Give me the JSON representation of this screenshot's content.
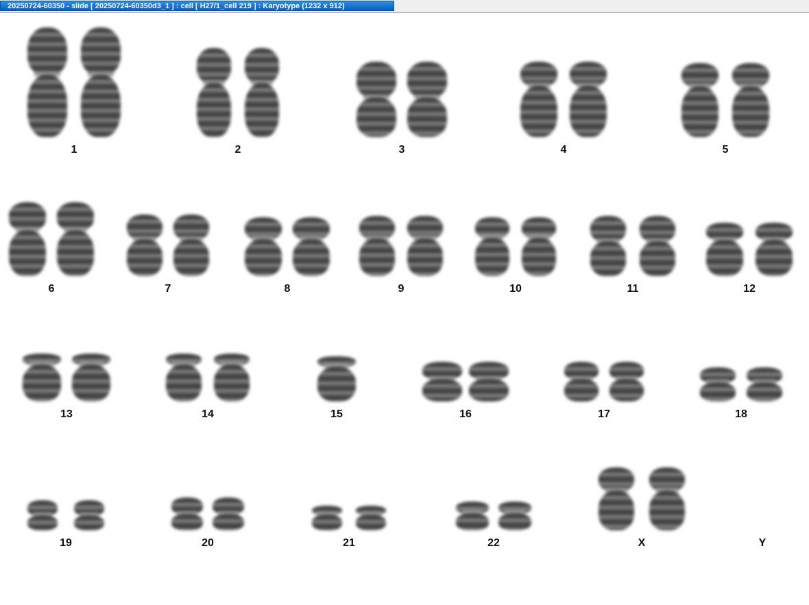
{
  "window": {
    "title": "20250724-60350 - slide [ 20250724-60350d3_1 ] : cell [ H27/1_cell 219 ] : Karyotype  (1232 x 912)"
  },
  "colors": {
    "title_bar": "#1577d6",
    "title_text": "#ffffff",
    "background": "#ffffff",
    "chromosome": "#3a3a3a"
  },
  "karyotype": {
    "chromosomes": [
      {
        "label": "1",
        "count": 2
      },
      {
        "label": "2",
        "count": 2
      },
      {
        "label": "3",
        "count": 2
      },
      {
        "label": "4",
        "count": 2
      },
      {
        "label": "5",
        "count": 2
      },
      {
        "label": "6",
        "count": 2
      },
      {
        "label": "7",
        "count": 2
      },
      {
        "label": "8",
        "count": 2
      },
      {
        "label": "9",
        "count": 2
      },
      {
        "label": "10",
        "count": 2
      },
      {
        "label": "11",
        "count": 2
      },
      {
        "label": "12",
        "count": 2
      },
      {
        "label": "13",
        "count": 2
      },
      {
        "label": "14",
        "count": 2
      },
      {
        "label": "15",
        "count": 1
      },
      {
        "label": "16",
        "count": 2
      },
      {
        "label": "17",
        "count": 2
      },
      {
        "label": "18",
        "count": 2
      },
      {
        "label": "19",
        "count": 2
      },
      {
        "label": "20",
        "count": 2
      },
      {
        "label": "21",
        "count": 2
      },
      {
        "label": "22",
        "count": 2
      },
      {
        "label": "X",
        "count": 2
      },
      {
        "label": "Y",
        "count": 0
      }
    ]
  }
}
